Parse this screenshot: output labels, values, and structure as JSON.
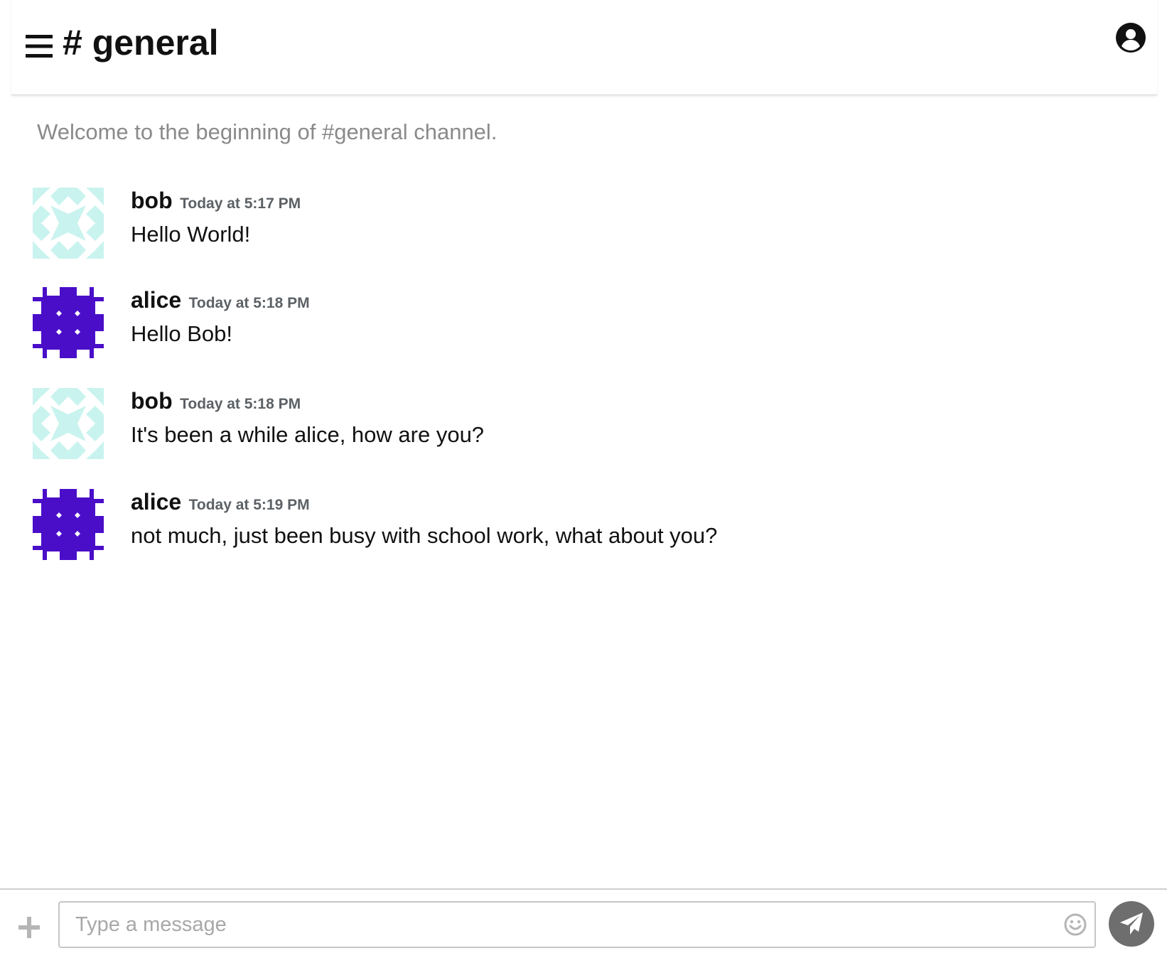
{
  "header": {
    "channel_title": "# general",
    "menu_icon": "hamburger-menu-icon",
    "account_icon": "user-circle-icon"
  },
  "welcome_text": "Welcome to the beginning of #general channel.",
  "messages": [
    {
      "author": "bob",
      "time": "Today at 5:17 PM",
      "text": "Hello World!",
      "avatar_color": "#c9f3ee"
    },
    {
      "author": "alice",
      "time": "Today at 5:18 PM",
      "text": "Hello Bob!",
      "avatar_color": "#4a0ec9"
    },
    {
      "author": "bob",
      "time": "Today at 5:18 PM",
      "text": "It's been a while alice, how are you?",
      "avatar_color": "#c9f3ee"
    },
    {
      "author": "alice",
      "time": "Today at 5:19 PM",
      "text": "not much, just been busy with school work, what about you?",
      "avatar_color": "#4a0ec9"
    }
  ],
  "composer": {
    "placeholder": "Type a message",
    "value": "",
    "add_icon": "plus-icon",
    "emoji_icon": "smiley-icon",
    "send_icon": "paper-plane-icon",
    "send_button_color": "#6e6e6e"
  }
}
